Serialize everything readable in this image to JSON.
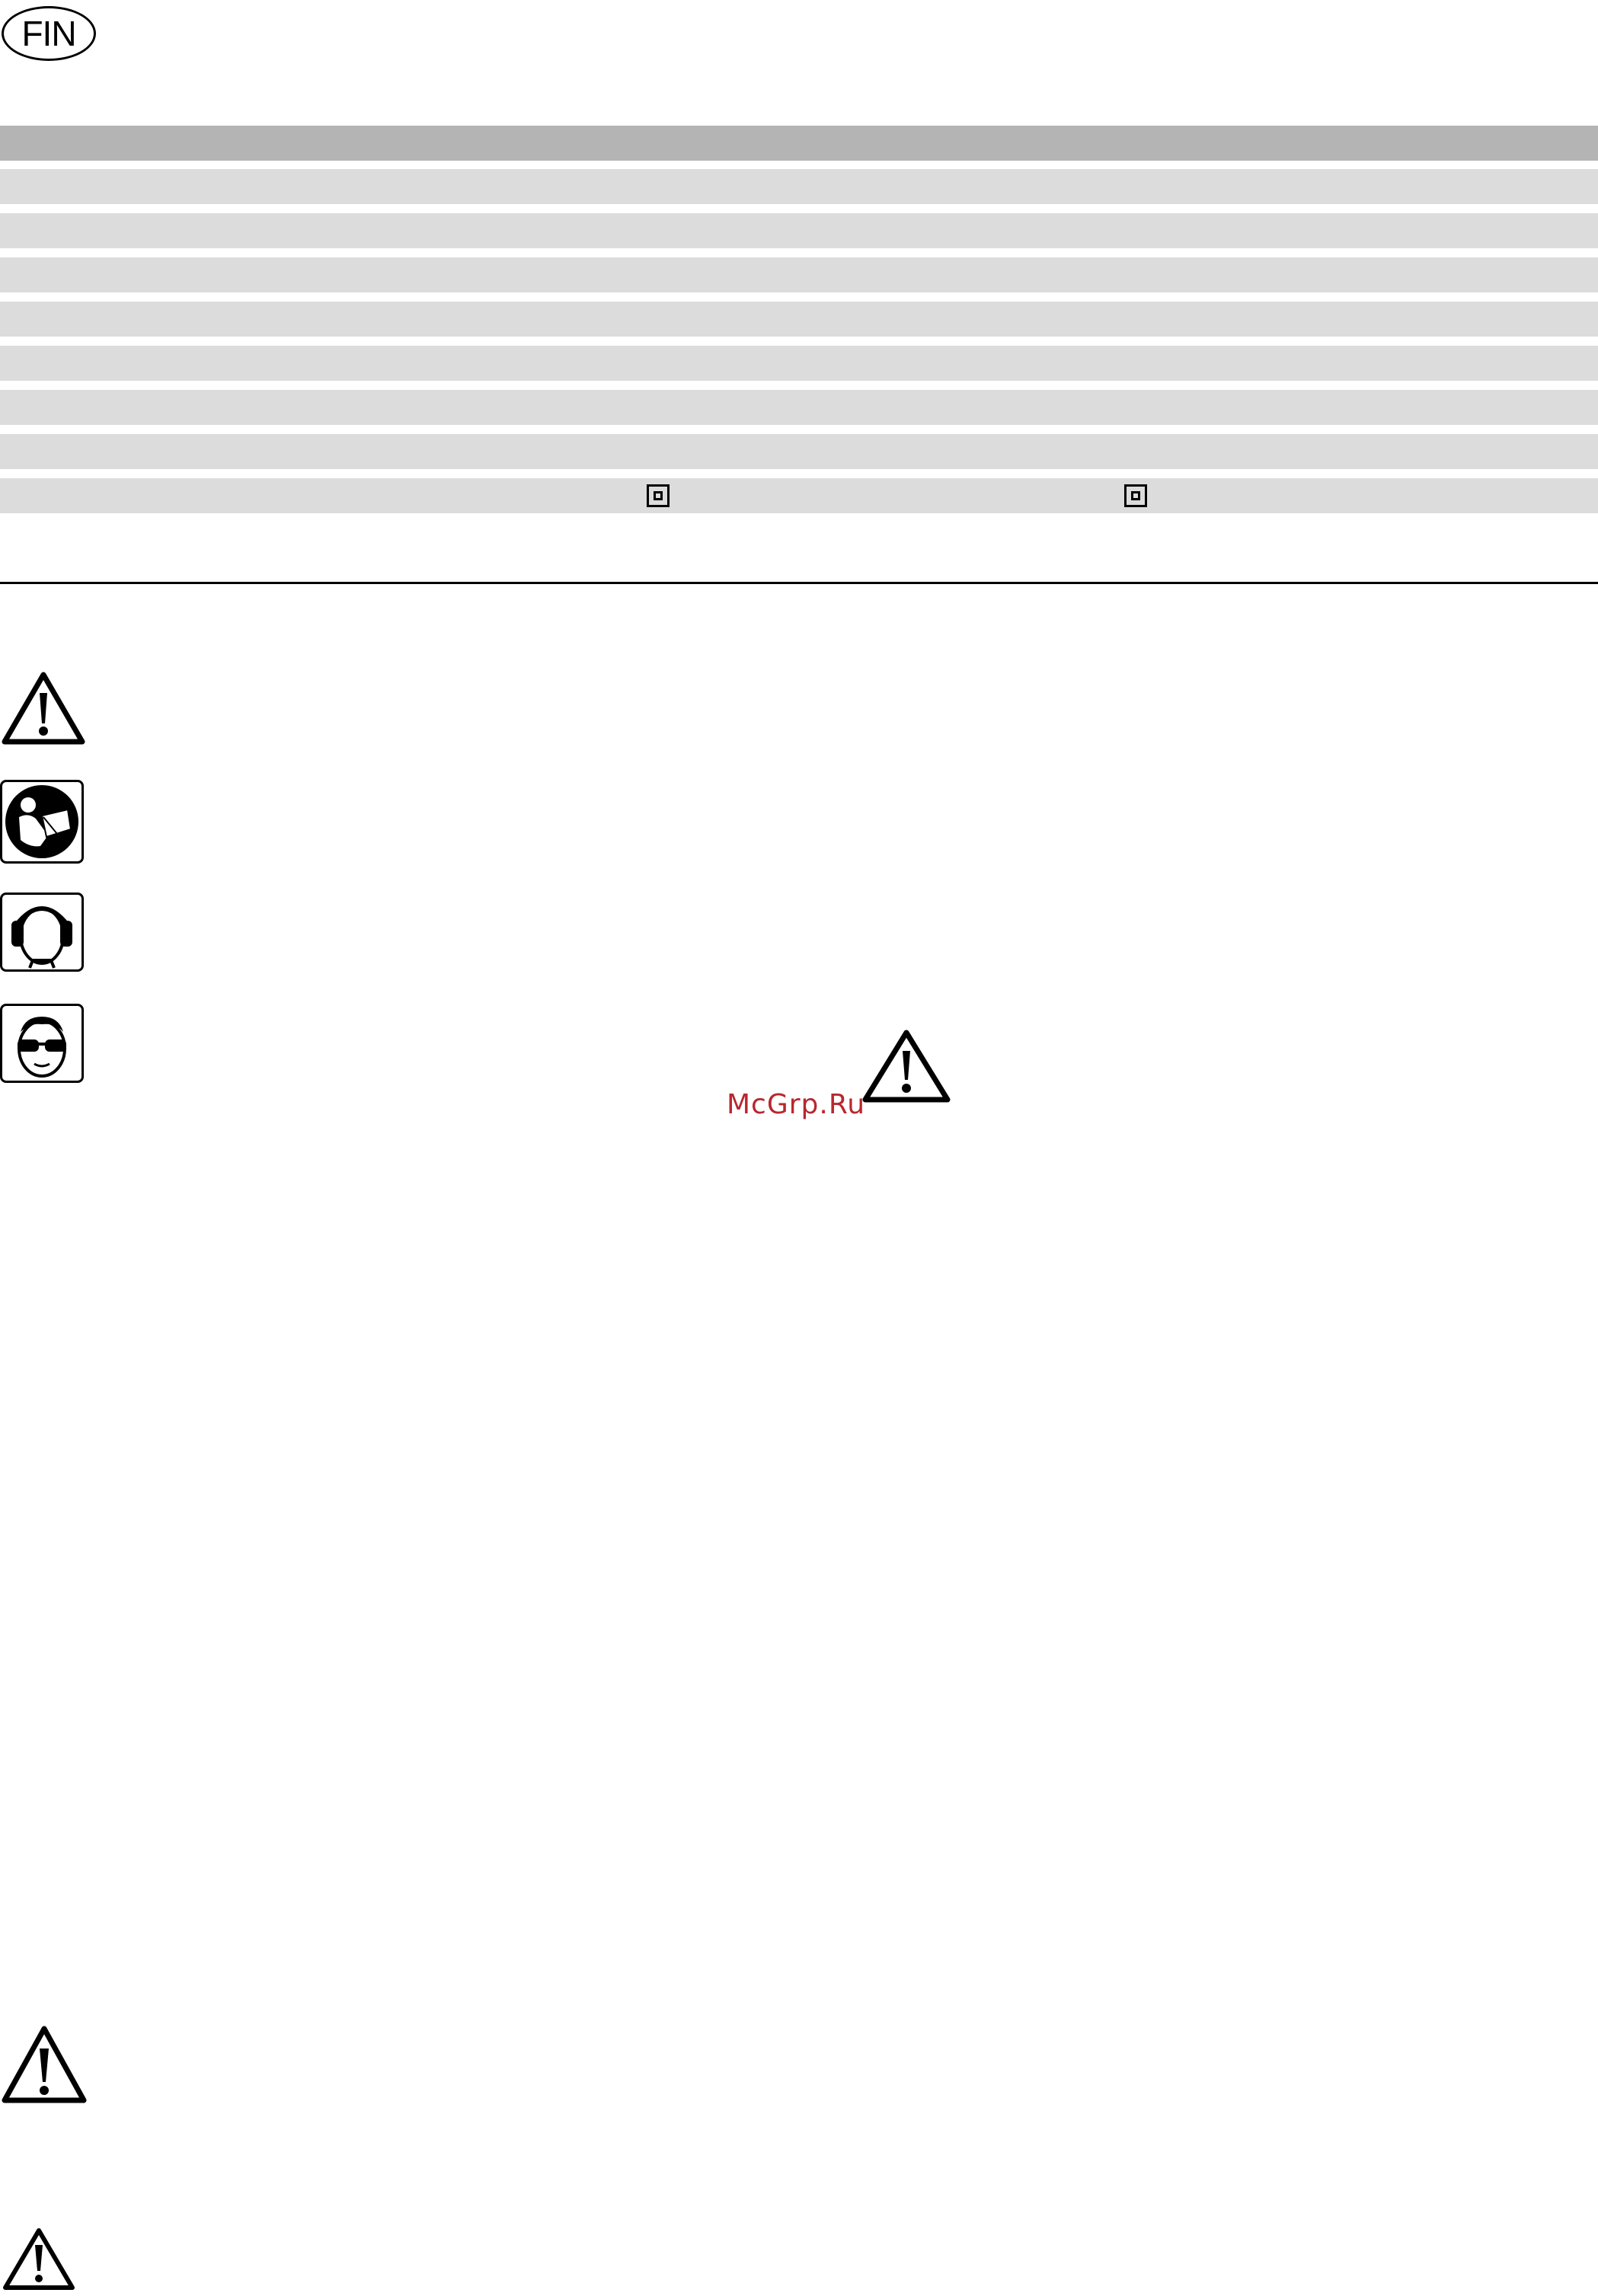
{
  "header": {
    "country_code": "FIN"
  },
  "spec_table": {
    "header_row": "",
    "rows": [
      "",
      "",
      "",
      "",
      "",
      "",
      "",
      ""
    ],
    "protection_class_symbol": "class-ii-double-insulation-icon"
  },
  "symbols": {
    "warning": "warning-triangle-icon",
    "read_manual": "read-manual-icon",
    "ear_protection": "ear-protection-icon",
    "eye_protection": "eye-protection-icon"
  },
  "watermark": {
    "text": "McGrp.Ru",
    "color": "#b8272e"
  },
  "colors": {
    "table_header": "#b4b4b4",
    "table_row": "#dcdcdc"
  }
}
